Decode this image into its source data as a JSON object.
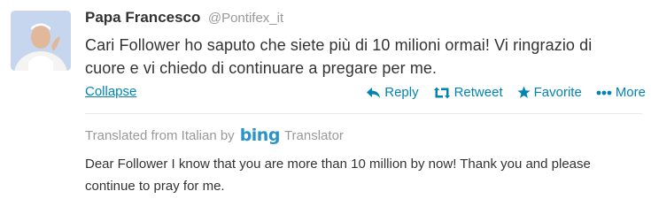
{
  "tweet": {
    "author_name": "Papa Francesco",
    "author_handle": "@Pontifex_it",
    "text": "Cari Follower ho saputo che siete più di 10 milioni ormai! Vi ringrazio di cuore e vi chiedo di continuare a pregare per me.",
    "collapse_label": "Collapse"
  },
  "actions": {
    "reply": "Reply",
    "retweet": "Retweet",
    "favorite": "Favorite",
    "more": "More"
  },
  "translation": {
    "prefix": "Translated from Italian by",
    "service": "bing",
    "suffix": "Translator",
    "text": "Dear Follower I know that you are more than 10 million by now! Thank you and please continue to pray for me."
  },
  "colors": {
    "link": "#0084b4",
    "muted": "#999999",
    "text": "#333333",
    "bing": "#2a94c9"
  }
}
